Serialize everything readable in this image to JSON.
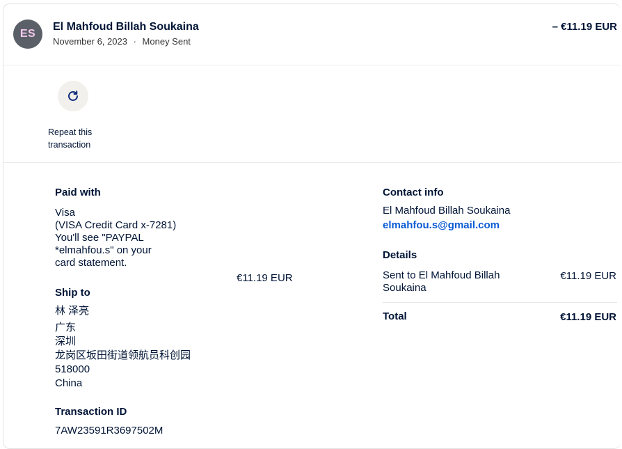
{
  "header": {
    "avatar_initials": "ES",
    "name": "El Mahfoud Billah Soukaina",
    "date": "November 6, 2023",
    "separator": "·",
    "type": "Money Sent",
    "amount": "– €11.19 EUR"
  },
  "actions": {
    "repeat_label": "Repeat this transaction",
    "repeat_icon": "refresh-icon"
  },
  "paid_with": {
    "title": "Paid with",
    "lines": [
      "Visa",
      "(VISA Credit Card x-7281)",
      "You'll see \"PAYPAL",
      "*elmahfou.s\" on your",
      "card statement."
    ],
    "amount": "€11.19 EUR"
  },
  "ship_to": {
    "title": "Ship to",
    "lines": [
      "林 泽亮",
      "广东",
      "深圳",
      "龙岗区坂田街道领航员科创园",
      "518000",
      "China"
    ]
  },
  "transaction": {
    "title": "Transaction ID",
    "id": "7AW23591R3697502M"
  },
  "contact": {
    "title": "Contact info",
    "name": "El Mahfoud Billah Soukaina",
    "email": "elmahfou.s@gmail.com"
  },
  "details": {
    "title": "Details",
    "sent_to_line1": "Sent to El Mahfoud Billah",
    "sent_to_line2": "Soukaina",
    "sent_amount": "€11.19 EUR",
    "total_label": "Total",
    "total_amount": "€11.19 EUR"
  }
}
